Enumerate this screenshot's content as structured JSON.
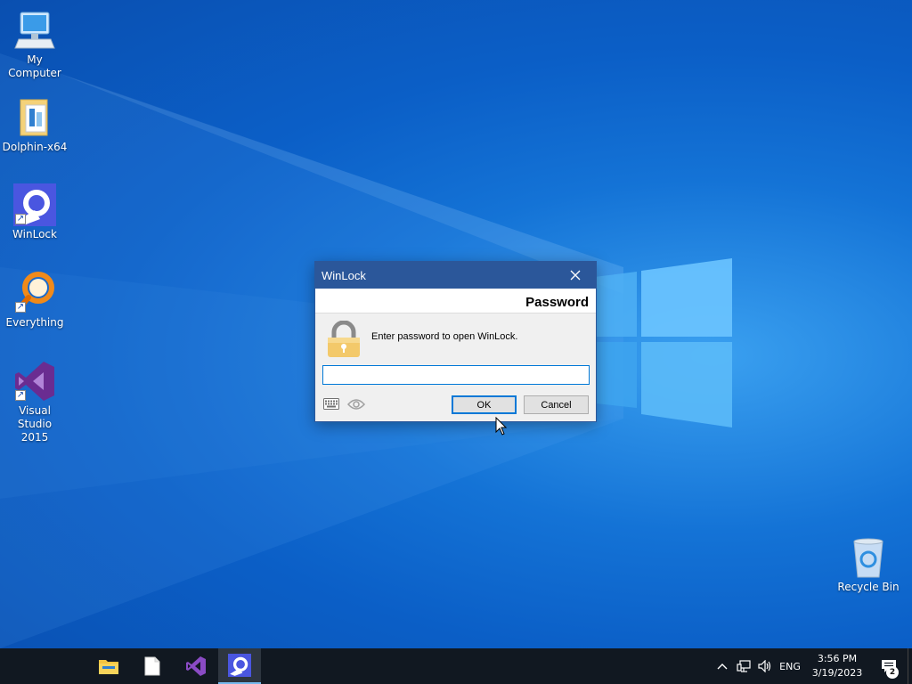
{
  "desktop": {
    "icons": [
      {
        "label": "My Computer",
        "icon": "computer-icon"
      },
      {
        "label": "Dolphin-x64",
        "icon": "folder-icon"
      },
      {
        "label": "WinLock",
        "icon": "winlock-icon"
      },
      {
        "label": "Everything",
        "icon": "search-magnifier-icon"
      },
      {
        "label": "Visual Studio\n2015",
        "icon": "visual-studio-icon"
      },
      {
        "label": "Recycle Bin",
        "icon": "recycle-bin-icon"
      }
    ]
  },
  "dialog": {
    "title": "WinLock",
    "heading": "Password",
    "message": "Enter password to open WinLock.",
    "password_value": "",
    "ok_label": "OK",
    "cancel_label": "Cancel",
    "accent": "#2b579a"
  },
  "taskbar": {
    "apps": [
      {
        "name": "file-explorer",
        "icon": "folder-icon"
      },
      {
        "name": "document",
        "icon": "document-icon"
      },
      {
        "name": "visual-studio",
        "icon": "visual-studio-icon"
      },
      {
        "name": "winlock",
        "icon": "winlock-icon",
        "active": true
      }
    ],
    "tray": {
      "language": "ENG",
      "time": "3:56 PM",
      "date": "3/19/2023",
      "notification_count": "2"
    }
  }
}
